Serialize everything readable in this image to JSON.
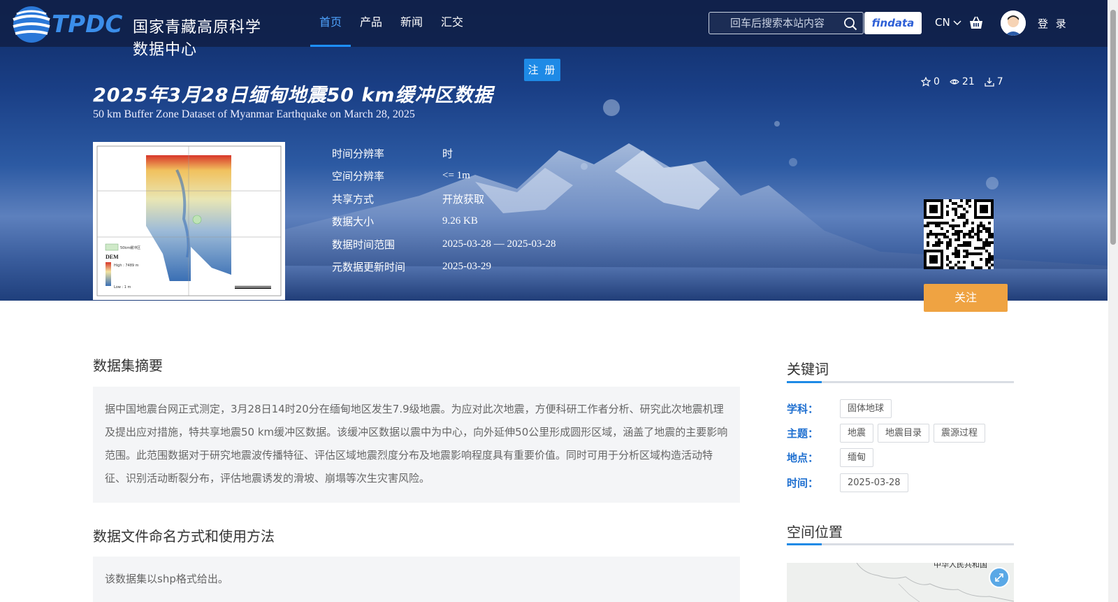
{
  "header": {
    "logo_text": "国家青藏高原科学数据中心",
    "logo_abbr": "TPDC",
    "nav": [
      {
        "label": "首页",
        "active": true
      },
      {
        "label": "产品"
      },
      {
        "label": "新闻"
      },
      {
        "label": "汇交"
      }
    ],
    "search_placeholder": "回车后搜索本站内容",
    "findata": "findata",
    "lang": "CN",
    "login": "登 录"
  },
  "register_label": "注 册",
  "dataset": {
    "title_cn": "2025年3月28日缅甸地震50  km缓冲区数据",
    "title_en": "50 km Buffer Zone Dataset of Myanmar Earthquake on March 28, 2025",
    "stats": {
      "stars": "0",
      "views": "21",
      "downloads": "7"
    },
    "meta": [
      {
        "key": "时间分辨率",
        "value": "时"
      },
      {
        "key": "空间分辨率",
        "value": "<= 1m"
      },
      {
        "key": "共享方式",
        "value": "开放获取"
      },
      {
        "key": "数据大小",
        "value": "9.26 KB"
      },
      {
        "key": "数据时间范围",
        "value": "2025-03-28 — 2025-03-28"
      },
      {
        "key": "元数据更新时间",
        "value": "2025-03-29"
      }
    ],
    "follow_label": "关注",
    "thumb": {
      "legend_buffer": "50km缓冲区",
      "legend_dem": "DEM",
      "legend_high": "High : 7489 m",
      "legend_low": "Low : 1 m"
    }
  },
  "abstract": {
    "title": "数据集摘要",
    "text": "据中国地震台网正式测定，3月28日14时20分在缅甸地区发生7.9级地震。为应对此次地震，方便科研工作者分析、研究此次地震机理及提出应对措施，特共享地震50 km缓冲区数据。该缓冲区数据以震中为中心，向外延伸50公里形成圆形区域，涵盖了地震的主要影响范围。此范围数据对于研究地震波传播特征、评估区域地震烈度分布及地震影响程度具有重要价值。同时可用于分析区域构造活动特征、识别活动断裂分布，评估地震诱发的滑坡、崩塌等次生灾害风险。"
  },
  "naming": {
    "title": "数据文件命名方式和使用方法",
    "text": "该数据集以shp格式给出。"
  },
  "keywords": {
    "title": "关键词",
    "rows": [
      {
        "label": "学科：",
        "tags": [
          "固体地球"
        ]
      },
      {
        "label": "主题：",
        "tags": [
          "地震",
          "地震目录",
          "震源过程"
        ]
      },
      {
        "label": "地点：",
        "tags": [
          "缅甸"
        ]
      },
      {
        "label": "时间：",
        "tags": [
          "2025-03-28"
        ]
      }
    ]
  },
  "spatial": {
    "title": "空间位置",
    "map_label": "中华人民共和国"
  },
  "colors": {
    "accent": "#1e8ae6",
    "follow": "#efa342",
    "keyword_label": "#1e6fd0"
  }
}
